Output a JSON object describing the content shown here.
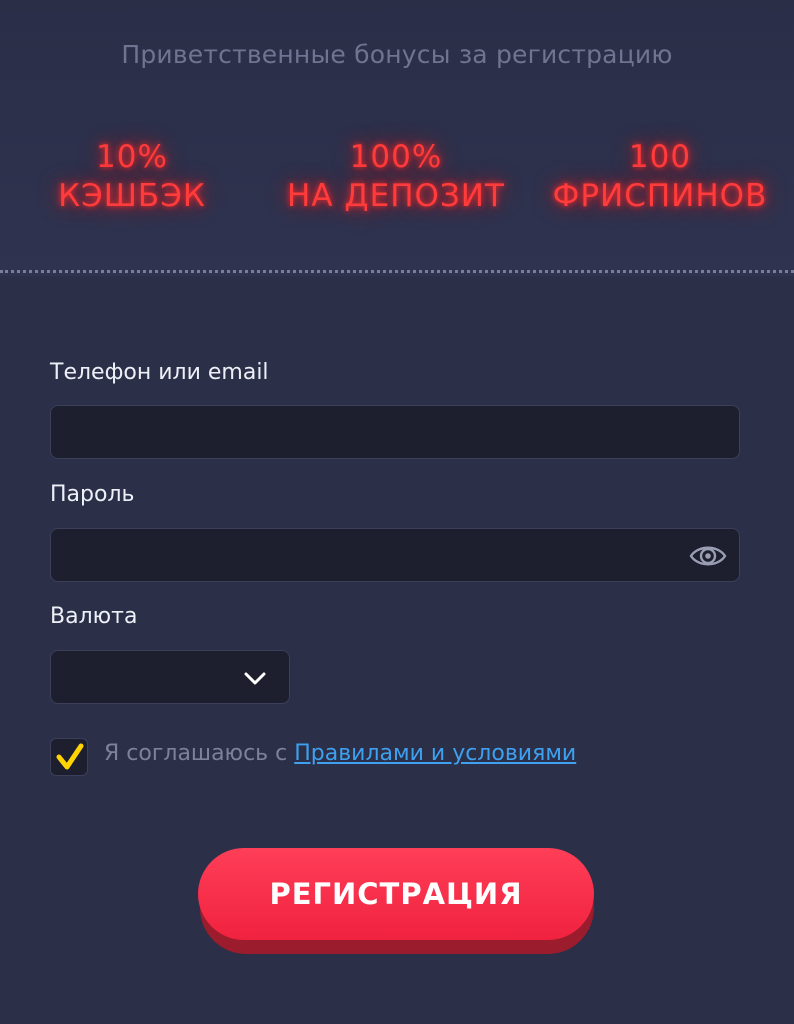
{
  "bonuses": {
    "title": "Приветственные бонусы за регистрацию",
    "items": [
      {
        "line1": "10%",
        "line2": "КЭШБЭК"
      },
      {
        "line1": "100%",
        "line2": "НА ДЕПОЗИТ"
      },
      {
        "line1": "100",
        "line2": "ФРИСПИНОВ"
      }
    ],
    "glow_color": "#ff3b3b"
  },
  "form": {
    "login_label": "Телефон или email",
    "login_value": "",
    "password_label": "Пароль",
    "password_value": "",
    "currency_label": "Валюта",
    "currency_value": "",
    "agree_text": "Я соглашаюсь с ",
    "terms_link": "Правилами и условиями",
    "agree_checked": true,
    "submit_label": "РЕГИСТРАЦИЯ"
  },
  "icons": {
    "password_toggle": "eye-icon",
    "currency_dropdown": "chevron-down-icon",
    "agree_check": "check-icon"
  },
  "colors": {
    "background": "#2b2f48",
    "input_bg": "#1d1e2e",
    "accent_button": "#f0223f",
    "checkmark": "#ffd400",
    "link": "#3ea0ee"
  }
}
